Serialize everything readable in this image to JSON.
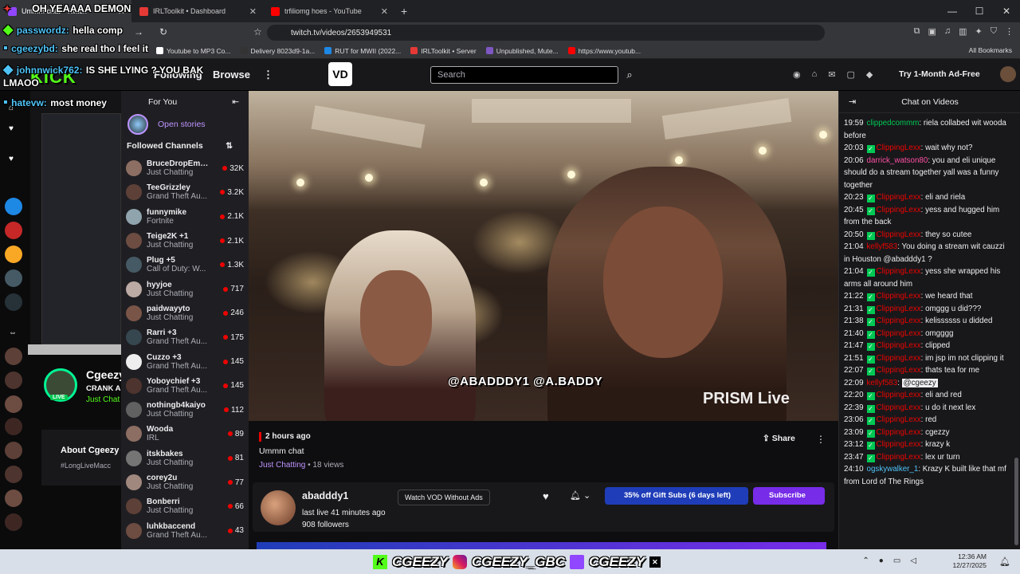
{
  "browser": {
    "tabs": [
      {
        "title": "Ummm chat - Twitch",
        "active": true
      },
      {
        "title": "IRLToolkit • Dashboard",
        "active": false
      },
      {
        "title": "trfiliomg hoes - YouTube",
        "active": false
      }
    ],
    "url": "twitch.tv/videos/2653949531",
    "bookmarks": [
      "Youtube to MP3 Co...",
      "Delivery 8023d9-1a...",
      "RUT for MWII (2022...",
      "IRLToolkit • Server",
      "Unpublished, Mute...",
      "https://www.youtub..."
    ],
    "all_bookmarks": "All Bookmarks"
  },
  "overlay_chat": [
    {
      "user": "passwordz:",
      "text": "hella comp",
      "color": "#4fc3f7"
    },
    {
      "user": "cgeezybd:",
      "text": "she real tho I feel it",
      "color": "#4fc3f7"
    },
    {
      "user": "johnnwick762:",
      "text": "IS SHE LYING ? YOU BAK",
      "color": "#4fc3f7"
    },
    {
      "user": "",
      "text": "LMAOO",
      "color": "#ffffff"
    },
    {
      "user": "hatevw:",
      "text": "most money",
      "color": "#4fc3f7"
    }
  ],
  "overlay_top_banner": "OH YEAAAA DEMON",
  "overlay_kick_logo": "KICK",
  "twitch_nav": {
    "following": "Following",
    "browse": "Browse",
    "logo": "VD",
    "search_placeholder": "Search",
    "ad_free": "Try 1-Month Ad-Free"
  },
  "sidebar": {
    "header": "For You",
    "stories": "Open stories",
    "followed_title": "Followed Channels",
    "channels": [
      {
        "name": "BruceDropEmOff",
        "game": "Just Chatting",
        "viewers": "32K",
        "color": "#8d6e63"
      },
      {
        "name": "TeeGrizzley",
        "game": "Grand Theft Au...",
        "viewers": "3.2K",
        "color": "#5d4037"
      },
      {
        "name": "funnymike",
        "game": "Fortnite",
        "viewers": "2.1K",
        "color": "#90a4ae"
      },
      {
        "name": "Teige2K +1",
        "game": "Just Chatting",
        "viewers": "2.1K",
        "color": "#6d4c41"
      },
      {
        "name": "Plug +5",
        "game": "Call of Duty: W...",
        "viewers": "1.3K",
        "color": "#455a64"
      },
      {
        "name": "hyyjoe",
        "game": "Just Chatting",
        "viewers": "717",
        "color": "#bcaaa4"
      },
      {
        "name": "paidwayyto",
        "game": "Just Chatting",
        "viewers": "246",
        "color": "#795548"
      },
      {
        "name": "Rarri +3",
        "game": "Grand Theft Au...",
        "viewers": "175",
        "color": "#37474f"
      },
      {
        "name": "Cuzzo +3",
        "game": "Grand Theft Au...",
        "viewers": "145",
        "color": "#eeeeee"
      },
      {
        "name": "Yoboychief +3",
        "game": "Grand Theft Au...",
        "viewers": "145",
        "color": "#4e342e"
      },
      {
        "name": "nothingb4kaiyo",
        "game": "Just Chatting",
        "viewers": "112",
        "color": "#616161"
      },
      {
        "name": "Wooda",
        "game": "IRL",
        "viewers": "89",
        "color": "#8d6e63"
      },
      {
        "name": "itskbakes",
        "game": "Just Chatting",
        "viewers": "81",
        "color": "#757575"
      },
      {
        "name": "corey2u",
        "game": "Just Chatting",
        "viewers": "77",
        "color": "#a1887f"
      },
      {
        "name": "Bonberri",
        "game": "Just Chatting",
        "viewers": "66",
        "color": "#5d4037"
      },
      {
        "name": "luhkbaccend",
        "game": "Grand Theft Au...",
        "viewers": "43",
        "color": "#6d4c41"
      }
    ]
  },
  "left_panel": {
    "streamer": "Cgeezy",
    "sub": "CRANK A",
    "category": "Just Chat",
    "live": "LIVE",
    "about": "About Cgeezy",
    "about_sub": "#LongLiveMacc"
  },
  "video": {
    "watermark_handles": "@ABADDDY1  @A.BADDY",
    "prism": "PRISM Live",
    "ago": "2 hours ago",
    "title": "Ummm chat",
    "category": "Just Chatting",
    "views": " • 18 views",
    "share": "Share"
  },
  "channel": {
    "name": "abadddy1",
    "last_live": "last live 41 minutes ago",
    "followers": "908 followers",
    "vod_button": "Watch VOD Without Ads",
    "gift_button": "35% off Gift Subs (6 days left)",
    "subscribe": "Subscribe"
  },
  "chat": {
    "title": "Chat on Videos",
    "messages": [
      {
        "time": "19:59",
        "user": "clippedcommm",
        "color": "#00c853",
        "badge": false,
        "text": ": riela collabed wit wooda before"
      },
      {
        "time": "20:03",
        "user": "ClippingLexx",
        "color": "#eb0400",
        "badge": true,
        "text": ": wait why not?"
      },
      {
        "time": "20:06",
        "user": "darrick_watson80",
        "color": "#ff4fa3",
        "badge": false,
        "text": ": you and eli unique should do a stream together yall was a funny together"
      },
      {
        "time": "20:23",
        "user": "ClippingLexx",
        "color": "#eb0400",
        "badge": true,
        "text": ": eli and riela"
      },
      {
        "time": "20:45",
        "user": "ClippingLexx",
        "color": "#eb0400",
        "badge": true,
        "text": ": yess and hugged him from the back"
      },
      {
        "time": "20:50",
        "user": "ClippingLexx",
        "color": "#eb0400",
        "badge": true,
        "text": ": they so cutee"
      },
      {
        "time": "21:04",
        "user": "kellyf583",
        "color": "#eb0400",
        "badge": false,
        "text": ": You doing a stream wit cauzzi in Houston @abadddy1 ?"
      },
      {
        "time": "21:04",
        "user": "ClippingLexx",
        "color": "#eb0400",
        "badge": true,
        "text": ": yess she wrapped his arms all around him"
      },
      {
        "time": "21:22",
        "user": "ClippingLexx",
        "color": "#eb0400",
        "badge": true,
        "text": ": we heard that"
      },
      {
        "time": "21:31",
        "user": "ClippingLexx",
        "color": "#eb0400",
        "badge": true,
        "text": ": omggg u did???"
      },
      {
        "time": "21:38",
        "user": "ClippingLexx",
        "color": "#eb0400",
        "badge": true,
        "text": ": kelissssss u didded"
      },
      {
        "time": "21:40",
        "user": "ClippingLexx",
        "color": "#eb0400",
        "badge": true,
        "text": ": omgggg"
      },
      {
        "time": "21:47",
        "user": "ClippingLexx",
        "color": "#eb0400",
        "badge": true,
        "text": ": clipped"
      },
      {
        "time": "21:51",
        "user": "ClippingLexx",
        "color": "#eb0400",
        "badge": true,
        "text": ": im jsp im not clipping it"
      },
      {
        "time": "22:07",
        "user": "ClippingLexx",
        "color": "#eb0400",
        "badge": true,
        "text": ": thats tea for me"
      },
      {
        "time": "22:09",
        "user": "kellyf583",
        "color": "#eb0400",
        "badge": false,
        "text": ": ",
        "mention": "@cgeezy"
      },
      {
        "time": "22:20",
        "user": "ClippingLexx",
        "color": "#eb0400",
        "badge": true,
        "text": ": eli and red"
      },
      {
        "time": "22:39",
        "user": "ClippingLexx",
        "color": "#eb0400",
        "badge": true,
        "text": ": u do it next lex"
      },
      {
        "time": "23:06",
        "user": "ClippingLexx",
        "color": "#eb0400",
        "badge": true,
        "text": ": red"
      },
      {
        "time": "23:09",
        "user": "ClippingLexx",
        "color": "#eb0400",
        "badge": true,
        "text": ": cgezzy"
      },
      {
        "time": "23:12",
        "user": "ClippingLexx",
        "color": "#eb0400",
        "badge": true,
        "text": ": krazy k"
      },
      {
        "time": "23:47",
        "user": "ClippingLexx",
        "color": "#eb0400",
        "badge": true,
        "text": ": lex ur turn"
      },
      {
        "time": "24:10",
        "user": "ogskywalker_1",
        "color": "#4fc3f7",
        "badge": false,
        "text": ": Krazy K built like that mf from Lord of The Rings"
      }
    ]
  },
  "taskbar": {
    "overlay_handles": [
      "CGEEZY",
      "CGEEZY_GBC",
      "CGEEZY"
    ],
    "time": "12:36 AM",
    "date": "12/27/2025"
  }
}
